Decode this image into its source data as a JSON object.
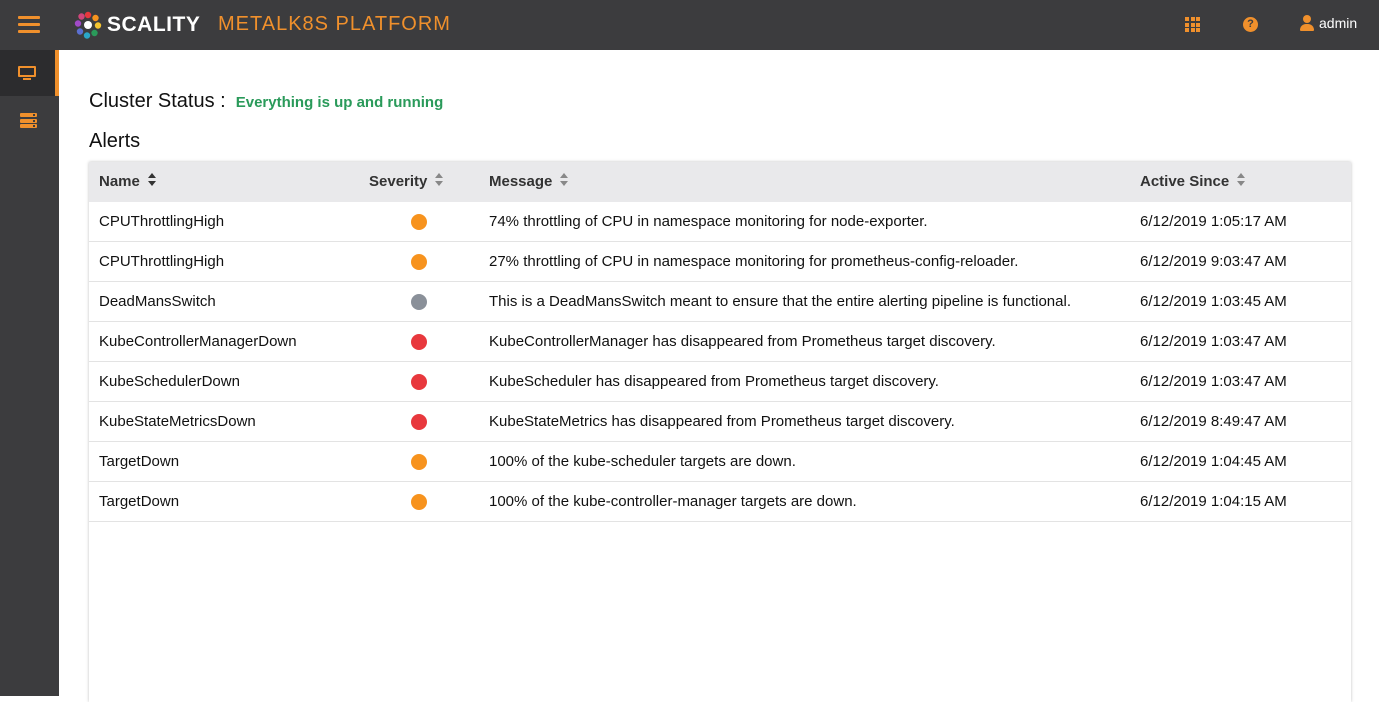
{
  "brand": {
    "logo_text": "SCALITY",
    "product_name": "METALK8S PLATFORM",
    "accent_color": "#f0902c"
  },
  "navbar": {
    "menu_icon": "hamburger-icon",
    "apps_icon": "apps-grid-icon",
    "help_icon": "help-icon",
    "help_glyph": "?",
    "user_icon": "user-icon",
    "user_name": "admin"
  },
  "sidebar": {
    "items": [
      {
        "icon": "monitor-icon",
        "active": true
      },
      {
        "icon": "server-icon",
        "active": false
      }
    ]
  },
  "cluster": {
    "label": "Cluster Status :",
    "status": "Everything is up and running",
    "status_color": "#2a9a5a"
  },
  "alerts": {
    "title": "Alerts",
    "columns": {
      "name": "Name",
      "severity": "Severity",
      "message": "Message",
      "active_since": "Active Since"
    },
    "severity_colors": {
      "warning": "#f7931e",
      "none": "#8a9099",
      "critical": "#e8383d"
    },
    "rows": [
      {
        "name": "CPUThrottlingHigh",
        "severity": "warning",
        "message": "74% throttling of CPU in namespace monitoring for node-exporter.",
        "active_since": "6/12/2019 1:05:17 AM"
      },
      {
        "name": "CPUThrottlingHigh",
        "severity": "warning",
        "message": "27% throttling of CPU in namespace monitoring for prometheus-config-reloader.",
        "active_since": "6/12/2019 9:03:47 AM"
      },
      {
        "name": "DeadMansSwitch",
        "severity": "none",
        "message": "This is a DeadMansSwitch meant to ensure that the entire alerting pipeline is functional.",
        "active_since": "6/12/2019 1:03:45 AM"
      },
      {
        "name": "KubeControllerManagerDown",
        "severity": "critical",
        "message": "KubeControllerManager has disappeared from Prometheus target discovery.",
        "active_since": "6/12/2019 1:03:47 AM"
      },
      {
        "name": "KubeSchedulerDown",
        "severity": "critical",
        "message": "KubeScheduler has disappeared from Prometheus target discovery.",
        "active_since": "6/12/2019 1:03:47 AM"
      },
      {
        "name": "KubeStateMetricsDown",
        "severity": "critical",
        "message": "KubeStateMetrics has disappeared from Prometheus target discovery.",
        "active_since": "6/12/2019 8:49:47 AM"
      },
      {
        "name": "TargetDown",
        "severity": "warning",
        "message": "100% of the kube-scheduler targets are down.",
        "active_since": "6/12/2019 1:04:45 AM"
      },
      {
        "name": "TargetDown",
        "severity": "warning",
        "message": "100% of the kube-controller-manager targets are down.",
        "active_since": "6/12/2019 1:04:15 AM"
      }
    ]
  }
}
